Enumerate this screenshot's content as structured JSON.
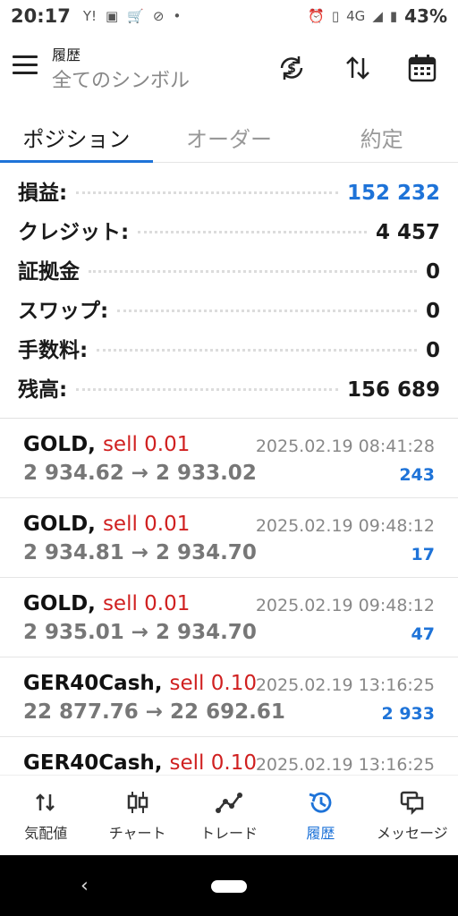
{
  "status_bar": {
    "time": "20:17",
    "network": "4G",
    "battery": "43%"
  },
  "app_bar": {
    "title": "履歴",
    "subtitle": "全てのシンボル"
  },
  "tabs": [
    {
      "label": "ポジション",
      "active": true
    },
    {
      "label": "オーダー",
      "active": false
    },
    {
      "label": "約定",
      "active": false
    }
  ],
  "summary": [
    {
      "label": "損益:",
      "value": "152 232",
      "highlight": true
    },
    {
      "label": "クレジット:",
      "value": "4 457",
      "highlight": false
    },
    {
      "label": "証拠金",
      "value": "0",
      "highlight": false
    },
    {
      "label": "スワップ:",
      "value": "0",
      "highlight": false
    },
    {
      "label": "手数料:",
      "value": "0",
      "highlight": false
    },
    {
      "label": "残高:",
      "value": "156 689",
      "highlight": false
    }
  ],
  "positions": [
    {
      "symbol": "GOLD,",
      "side": "sell 0.01",
      "prices": "2 934.62 → 2 933.02",
      "time": "2025.02.19 08:41:28",
      "profit": "243"
    },
    {
      "symbol": "GOLD,",
      "side": "sell 0.01",
      "prices": "2 934.81 → 2 934.70",
      "time": "2025.02.19 09:48:12",
      "profit": "17"
    },
    {
      "symbol": "GOLD,",
      "side": "sell 0.01",
      "prices": "2 935.01 → 2 934.70",
      "time": "2025.02.19 09:48:12",
      "profit": "47"
    },
    {
      "symbol": "GER40Cash,",
      "side": "sell 0.10",
      "prices": "22 877.76 → 22 692.61",
      "time": "2025.02.19 13:16:25",
      "profit": "2 933"
    },
    {
      "symbol": "GER40Cash,",
      "side": "sell 0.10",
      "prices": "",
      "time": "2025.02.19 13:16:25",
      "profit": ""
    }
  ],
  "bottom_nav": [
    {
      "label": "気配値",
      "icon": "quotes-icon",
      "active": false
    },
    {
      "label": "チャート",
      "icon": "candlestick-icon",
      "active": false
    },
    {
      "label": "トレード",
      "icon": "trade-icon",
      "active": false
    },
    {
      "label": "履歴",
      "icon": "history-icon",
      "active": true
    },
    {
      "label": "メッセージ",
      "icon": "messages-icon",
      "active": false
    }
  ],
  "colors": {
    "accent": "#1e73d8",
    "sell": "#d02020"
  }
}
